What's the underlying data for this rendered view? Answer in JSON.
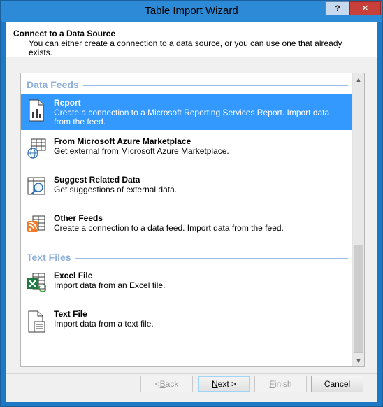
{
  "window": {
    "title": "Table Import Wizard",
    "help_glyph": "?",
    "close_glyph": "✕"
  },
  "header": {
    "title": "Connect to a Data Source",
    "description": "You can either create a connection to a data source, or you can use one that already exists."
  },
  "groups": [
    {
      "label": "Data Feeds",
      "items": [
        {
          "title": "Report",
          "desc": "Create a connection to a Microsoft Reporting Services Report. Import data from the feed.",
          "icon": "report-icon",
          "selected": true
        },
        {
          "title": "From Microsoft Azure Marketplace",
          "desc": "Get external from Microsoft Azure Marketplace.",
          "icon": "azure-marketplace-icon",
          "selected": false
        },
        {
          "title": "Suggest Related Data",
          "desc": "Get suggestions of external data.",
          "icon": "suggest-data-icon",
          "selected": false
        },
        {
          "title": "Other Feeds",
          "desc": "Create a connection to a data feed. Import data from the feed.",
          "icon": "data-feed-icon",
          "selected": false
        }
      ]
    },
    {
      "label": "Text Files",
      "items": [
        {
          "title": "Excel File",
          "desc": "Import data from an Excel file.",
          "icon": "excel-file-icon",
          "selected": false
        },
        {
          "title": "Text File",
          "desc": "Import data from a text file.",
          "icon": "text-file-icon",
          "selected": false
        }
      ]
    }
  ],
  "buttons": {
    "back_pre": "< ",
    "back_key": "B",
    "back_rest": "ack",
    "next_key": "N",
    "next_rest": "ext >",
    "finish_key": "F",
    "finish_rest": "inish",
    "cancel": "Cancel"
  },
  "colors": {
    "selection": "#3399ff",
    "group_header": "#8eafd8",
    "title_bar": "#2d8ad6"
  }
}
